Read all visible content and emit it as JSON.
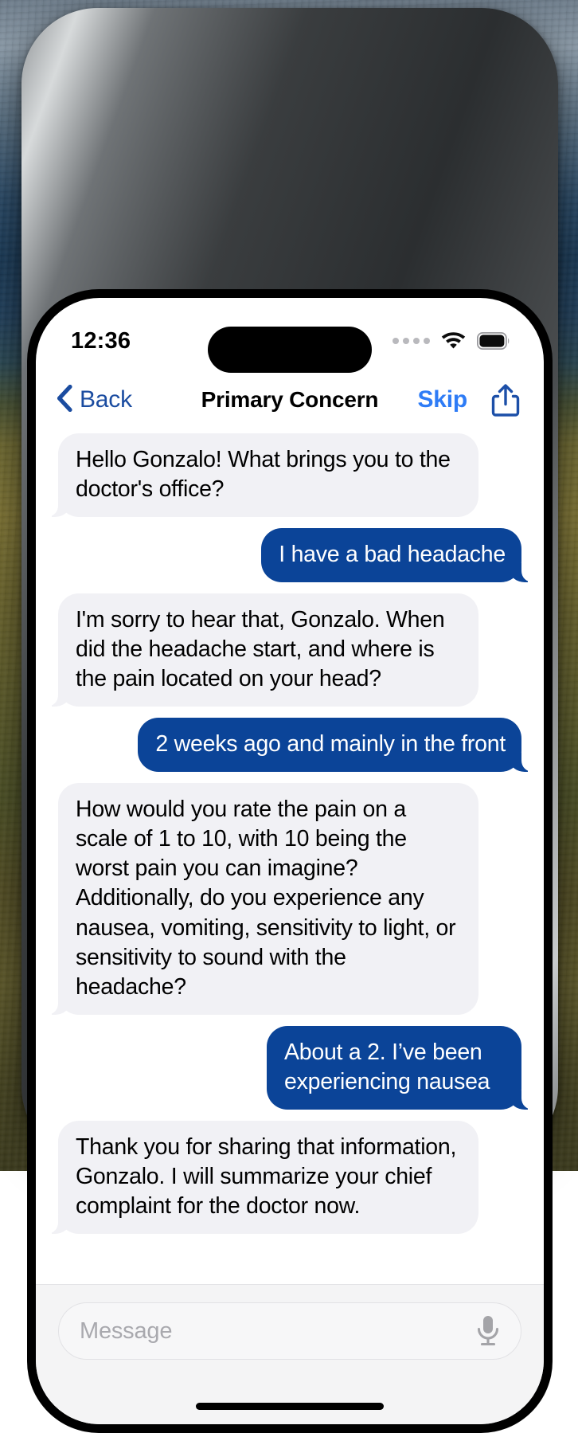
{
  "status_bar": {
    "time": "12:36",
    "cellular_icon": "signal-dots-icon",
    "wifi_icon": "wifi-icon",
    "battery_icon": "battery-full-icon"
  },
  "nav_bar": {
    "back_label": "Back",
    "back_icon": "chevron-left-icon",
    "title": "Primary Concern",
    "skip_label": "Skip",
    "share_icon": "share-icon"
  },
  "colors": {
    "incoming_bubble": "#f1f1f5",
    "outgoing_bubble": "#0b4498",
    "back_blue": "#1b4ca0",
    "skip_blue": "#2e7cf6",
    "share_blue": "#1c4fa8",
    "input_bar_bg": "#f4f4f5",
    "placeholder_gray": "#a9a9ae"
  },
  "conversation": {
    "messages": [
      {
        "sender": "assistant",
        "text": "Hello Gonzalo! What brings you to the doctor's office?"
      },
      {
        "sender": "user",
        "text": "I have a bad headache"
      },
      {
        "sender": "assistant",
        "text": "I'm sorry to hear that, Gonzalo. When did the headache start, and where is the pain located on your head?"
      },
      {
        "sender": "user",
        "text": "2 weeks ago and mainly in the front"
      },
      {
        "sender": "assistant",
        "text": "How would you rate the pain on a scale of 1 to 10, with 10 being the worst pain you can imagine? Additionally, do you experience any nausea, vomiting, sensitivity to light, or sensitivity to sound with the headache?"
      },
      {
        "sender": "user",
        "text": "About a 2. I’ve been experiencing nausea"
      },
      {
        "sender": "assistant",
        "text": "Thank you for sharing that information, Gonzalo. I will summarize your chief complaint for the doctor now."
      }
    ]
  },
  "input_bar": {
    "placeholder": "Message",
    "mic_icon": "microphone-icon"
  }
}
